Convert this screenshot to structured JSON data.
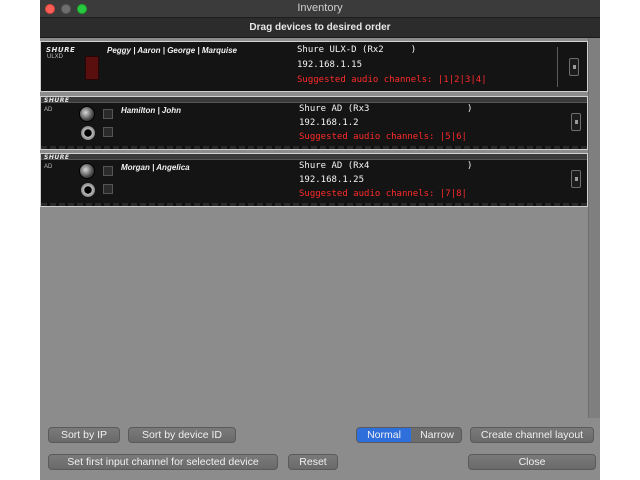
{
  "window": {
    "title": "Inventory",
    "subtitle": "Drag devices to desired order"
  },
  "devices": [
    {
      "brand": "SHURE",
      "model": "ULXD",
      "names": "Peggy | Aaron | George | Marquise",
      "title_line": "Shure ULX-D (Rx2     )",
      "ip": "192.168.1.15",
      "channels": "Suggested audio channels: |1|2|3|4|"
    },
    {
      "brand": "SHURE",
      "model": "AD",
      "names": "Hamilton | John",
      "title_line": "Shure AD (Rx3                  )",
      "ip": "192.168.1.2",
      "channels": "Suggested audio channels: |5|6|"
    },
    {
      "brand": "SHURE",
      "model": "AD",
      "names": "Morgan | Angelica",
      "title_line": "Shure AD (Rx4                  )",
      "ip": "192.168.1.25",
      "channels": "Suggested audio channels: |7|8|"
    }
  ],
  "buttons": {
    "sort_ip": "Sort by IP",
    "sort_device_id": "Sort by device ID",
    "normal": "Normal",
    "narrow": "Narrow",
    "create_layout": "Create channel layout",
    "set_first_input": "Set first input channel for selected device",
    "reset": "Reset",
    "close": "Close"
  },
  "view_mode_selected": "Normal",
  "colors": {
    "accent": "#2f6fdc",
    "channel_text": "#ff2a2a",
    "device_bg": "#141414",
    "window_bg": "#8c8c8c"
  }
}
